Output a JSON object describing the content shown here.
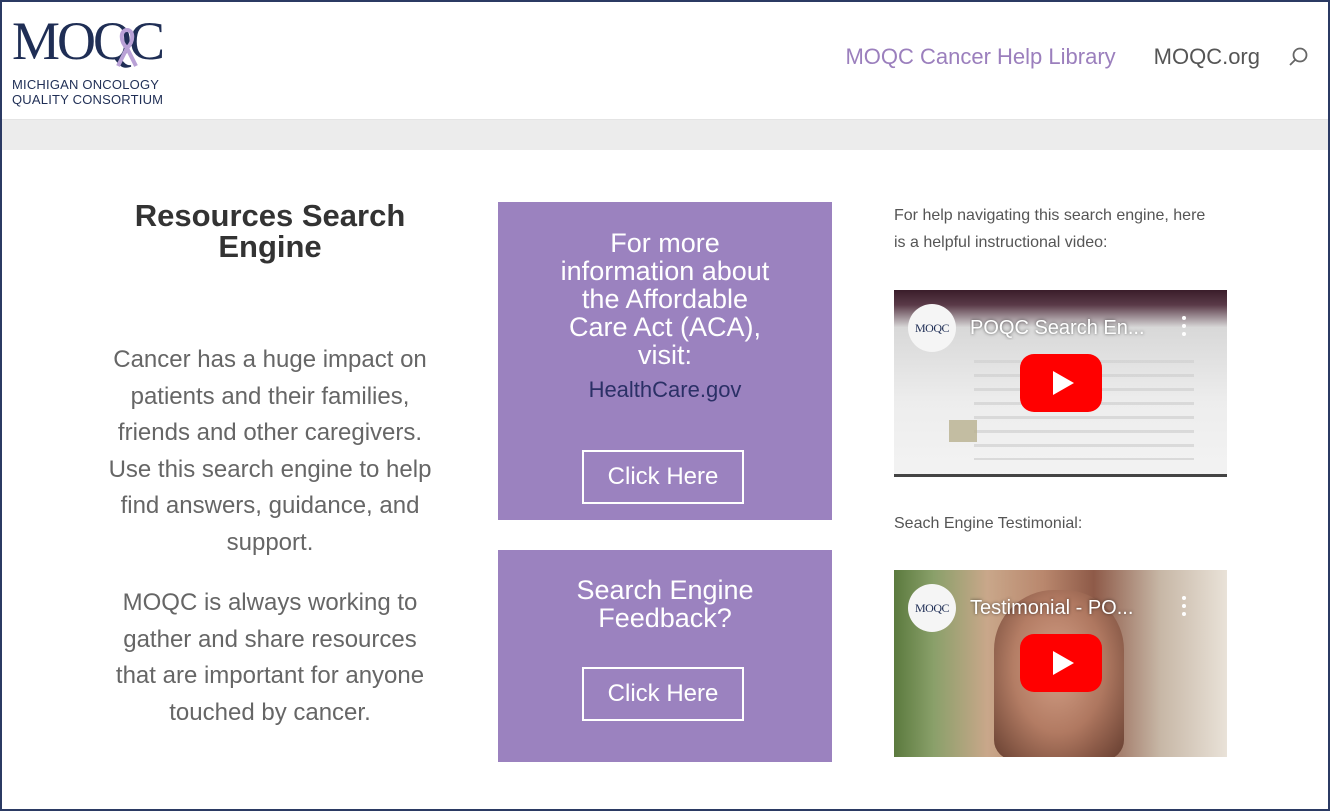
{
  "logo": {
    "mark": "MOQC",
    "line1": "MICHIGAN ONCOLOGY",
    "line2": "QUALITY CONSORTIUM"
  },
  "nav": {
    "items": [
      {
        "label": "MOQC Cancer Help Library",
        "active": true
      },
      {
        "label": "MOQC.org",
        "active": false
      }
    ],
    "search_icon": "search-icon"
  },
  "left": {
    "title": "Resources Search Engine",
    "paragraph1": "Cancer has a huge impact on patients and their families, friends and other caregivers. Use this search engine to help find answers, guidance, and support.",
    "paragraph2": "MOQC is always working to gather and share resources that are important for anyone touched by cancer."
  },
  "aca_box": {
    "heading": "For more information about the Affordable Care Act (ACA), visit:",
    "link_text": "HealthCare.gov",
    "button_label": "Click Here"
  },
  "feedback_box": {
    "heading": "Search Engine Feedback?",
    "button_label": "Click Here"
  },
  "right": {
    "help_text": "For help navigating this search engine, here is a helpful instructional video:",
    "video1": {
      "channel": "MOQC",
      "title": "POQC Search En..."
    },
    "testimonial_label": "Seach Engine Testimonial:",
    "video2": {
      "channel": "MOQC",
      "title": "Testimonial - PO..."
    }
  },
  "colors": {
    "accent_purple": "#9b82bf",
    "nav_active": "#9b7fbd",
    "link_navy": "#2b3066",
    "youtube_red": "#ff0000"
  }
}
